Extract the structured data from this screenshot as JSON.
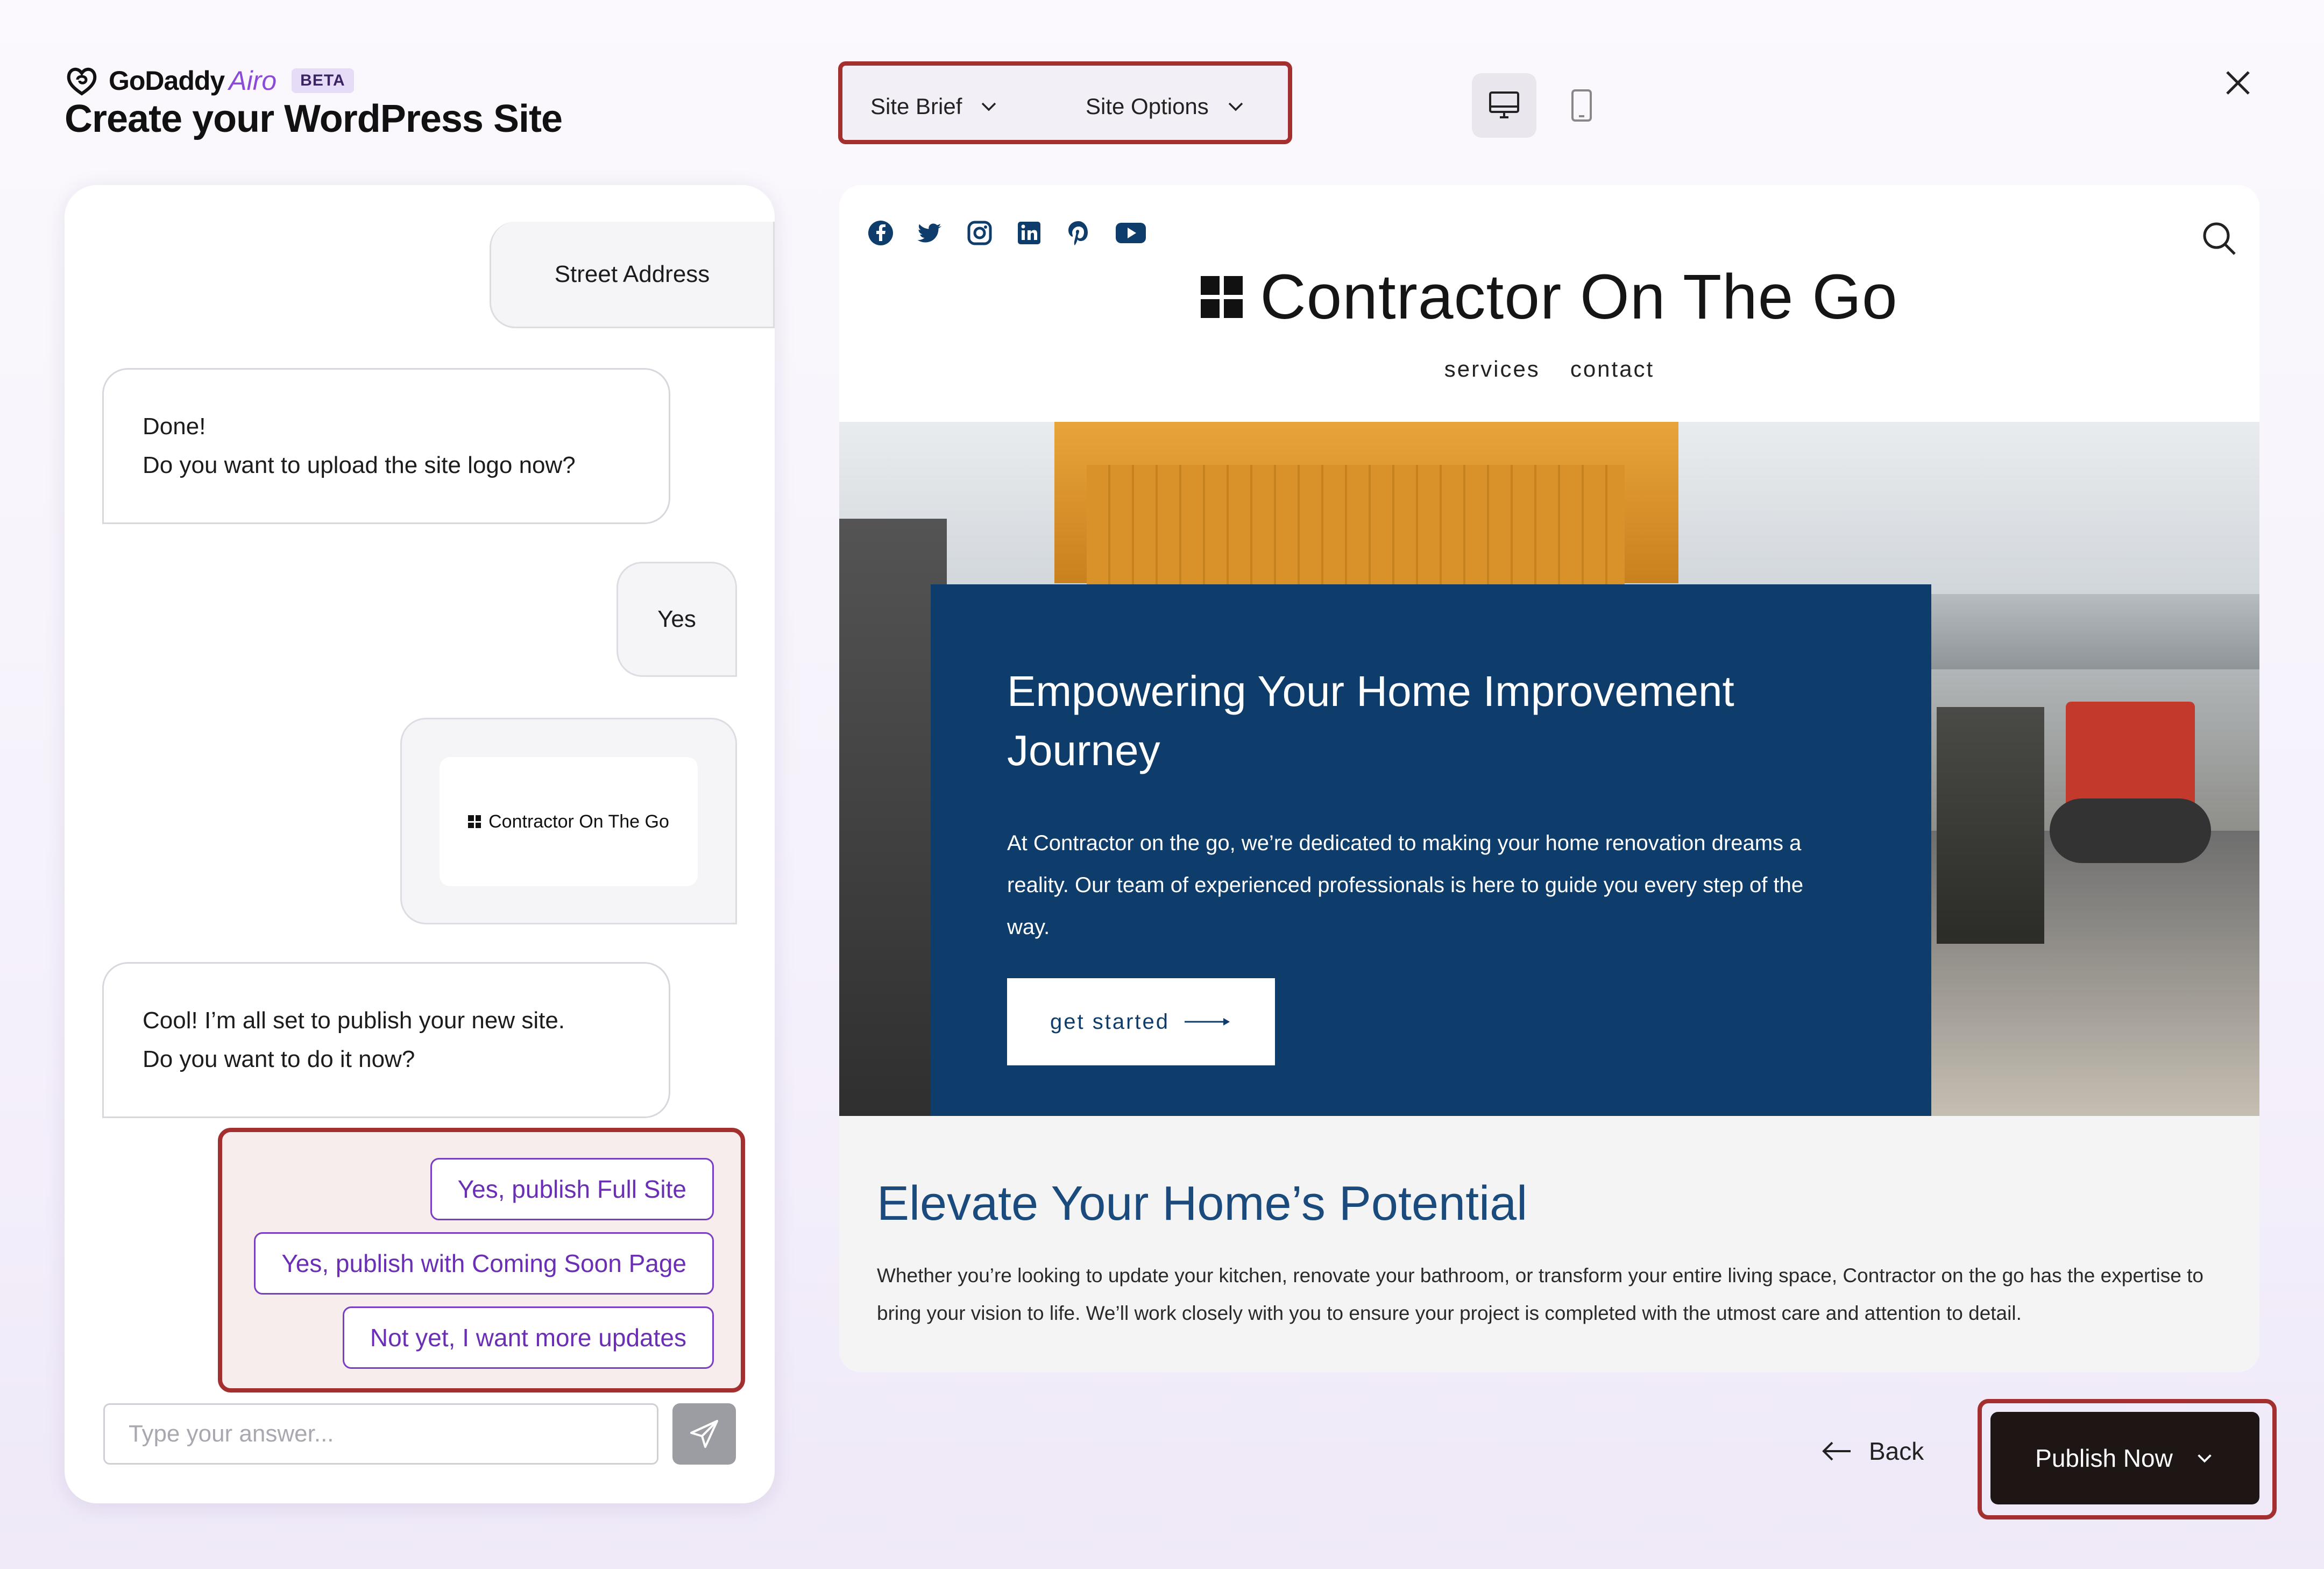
{
  "header": {
    "brand_name": "GoDaddy",
    "brand_product": "Airo",
    "beta_label": "BETA",
    "page_title": "Create your WordPress Site",
    "site_brief_label": "Site Brief",
    "site_options_label": "Site Options"
  },
  "chat": {
    "messages": [
      {
        "from": "user",
        "text": "Street Address"
      },
      {
        "from": "bot",
        "line1": "Done!",
        "line2": "Do you want to upload the site logo now?"
      },
      {
        "from": "user",
        "text": "Yes"
      },
      {
        "from": "user",
        "logo_text": "Contractor On The Go"
      },
      {
        "from": "bot",
        "line1": "Cool! I’m all set to publish your new site.",
        "line2": "Do you want to do it now?"
      }
    ],
    "options": [
      "Yes, publish Full Site",
      "Yes, publish with Coming Soon Page",
      "Not yet, I want more updates"
    ],
    "input_placeholder": "Type your answer..."
  },
  "preview": {
    "social_icons": [
      "facebook-icon",
      "twitter-icon",
      "instagram-icon",
      "linkedin-icon",
      "pinterest-icon",
      "youtube-icon"
    ],
    "site_title": "Contractor On The Go",
    "nav": [
      "services",
      "contact"
    ],
    "hero": {
      "heading": "Empowering Your Home Improvement Journey",
      "body": "At Contractor on the go, we’re dedicated to making your home renovation dreams a reality. Our team of experienced professionals is here to guide you every step of the way.",
      "cta": "get started"
    },
    "section2": {
      "heading": "Elevate Your Home’s Potential",
      "body": "Whether you’re looking to update your kitchen, renovate your bathroom, or transform your entire living space, Contractor on the go has the expertise to bring your vision to life. We’ll work closely with you to ensure your project is completed with the utmost care and attention to detail."
    }
  },
  "actions": {
    "back_label": "Back",
    "publish_label": "Publish Now"
  },
  "colors": {
    "accent_purple": "#7a3fc0",
    "highlight_red": "#a3302e",
    "hero_navy": "#0f3d6b",
    "publish_dark": "#1e1615"
  }
}
